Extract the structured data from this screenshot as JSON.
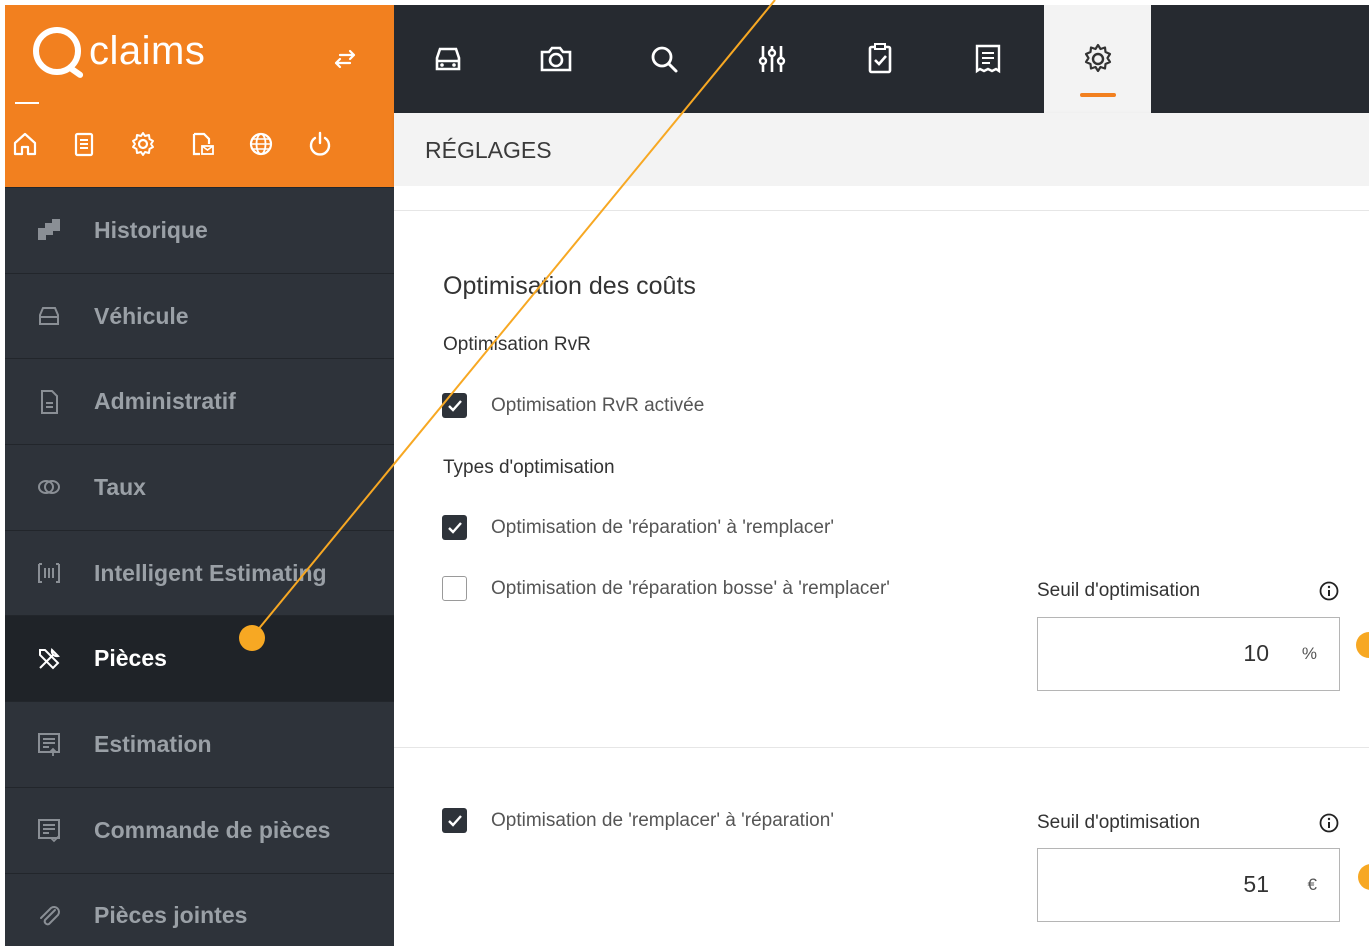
{
  "brand": {
    "name": "claims",
    "logo_letter": "Q"
  },
  "quick_icons": [
    "home-icon",
    "clipboard-icon",
    "gear-icon",
    "email-document-icon",
    "globe-icon",
    "power-icon"
  ],
  "sidebar": {
    "items": [
      {
        "label": "Historique",
        "icon": "history-icon",
        "active": false
      },
      {
        "label": "Véhicule",
        "icon": "car-icon",
        "active": false
      },
      {
        "label": "Administratif",
        "icon": "document-icon",
        "active": false
      },
      {
        "label": "Taux",
        "icon": "coins-icon",
        "active": false
      },
      {
        "label": "Intelligent Estimating",
        "icon": "barcode-icon",
        "active": false
      },
      {
        "label": "Pièces",
        "icon": "tools-icon",
        "active": true
      },
      {
        "label": "Estimation",
        "icon": "estimate-icon",
        "active": false
      },
      {
        "label": "Commande de pièces",
        "icon": "order-icon",
        "active": false
      },
      {
        "label": "Pièces jointes",
        "icon": "paperclip-icon",
        "active": false
      }
    ]
  },
  "topbar": {
    "icons": [
      "car-icon",
      "camera-icon",
      "search-icon",
      "sliders-icon",
      "checklist-icon",
      "receipt-icon",
      "gear-icon"
    ],
    "active": "gear-icon"
  },
  "subheader": {
    "title": "RÉGLAGES"
  },
  "content": {
    "section_title": "Optimisation des coûts",
    "rvr_heading": "Optimisation RvR",
    "rvr_checkbox": {
      "label": "Optimisation RvR activée",
      "checked": true
    },
    "types_heading": "Types d'optimisation",
    "opt1": {
      "label": "Optimisation de 'réparation' à 'remplacer'",
      "checked": true
    },
    "opt2": {
      "label": "Optimisation de 'réparation bosse' à 'remplacer'",
      "checked": false
    },
    "threshold1": {
      "label": "Seuil d'optimisation",
      "value": "10",
      "unit": "%"
    },
    "opt3": {
      "label": "Optimisation de 'remplacer' à 'réparation'",
      "checked": true
    },
    "threshold2": {
      "label": "Seuil d'optimisation",
      "value": "51",
      "unit": "€"
    }
  },
  "colors": {
    "accent": "#f2801f",
    "sidebar_bg": "#2e333a",
    "topbar_bg": "#262a30",
    "annotation": "#f7a823"
  }
}
